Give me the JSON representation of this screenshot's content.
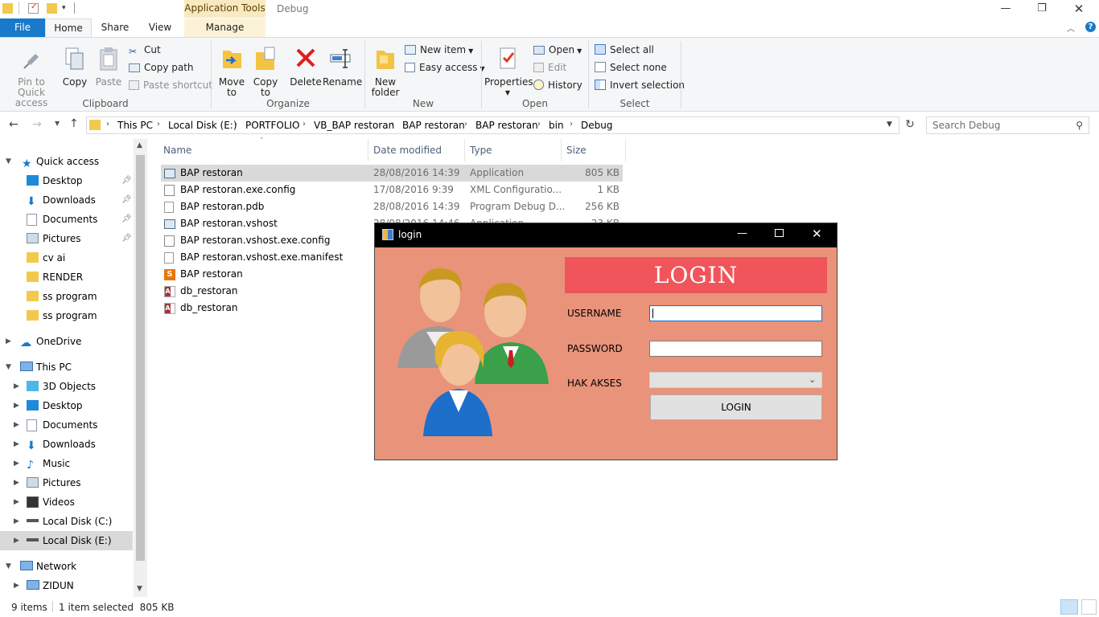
{
  "window": {
    "context_tab": "Application Tools",
    "title": "Debug",
    "controls": [
      "minimize",
      "restore",
      "close"
    ]
  },
  "tabs": {
    "file": "File",
    "home": "Home",
    "share": "Share",
    "view": "View",
    "manage": "Manage"
  },
  "ribbon": {
    "clipboard": {
      "label": "Clipboard",
      "pin": "Pin to Quick access",
      "copy": "Copy",
      "paste": "Paste",
      "cut": "Cut",
      "copy_path": "Copy path",
      "paste_shortcut": "Paste shortcut"
    },
    "organize": {
      "label": "Organize",
      "move_to": "Move to",
      "copy_to": "Copy to",
      "delete": "Delete",
      "rename": "Rename"
    },
    "new": {
      "label": "New",
      "new_folder": "New folder",
      "new_item": "New item",
      "easy_access": "Easy access"
    },
    "open": {
      "label": "Open",
      "properties": "Properties",
      "open": "Open",
      "edit": "Edit",
      "history": "History"
    },
    "select": {
      "label": "Select",
      "select_all": "Select all",
      "select_none": "Select none",
      "invert": "Invert selection"
    }
  },
  "address": {
    "crumbs": [
      "This PC",
      "Local Disk (E:)",
      "PORTFOLIO",
      "VB_BAP restoran",
      "BAP restoran",
      "BAP restoran",
      "bin",
      "Debug"
    ],
    "search_placeholder": "Search Debug"
  },
  "nav": {
    "quick_access": "Quick access",
    "quick_items": [
      "Desktop",
      "Downloads",
      "Documents",
      "Pictures",
      "cv ai",
      "RENDER",
      "ss program",
      "ss program"
    ],
    "onedrive": "OneDrive",
    "this_pc": "This PC",
    "pc_items": [
      "3D Objects",
      "Desktop",
      "Documents",
      "Downloads",
      "Music",
      "Pictures",
      "Videos",
      "Local Disk (C:)",
      "Local Disk (E:)"
    ],
    "network": "Network",
    "network_items": [
      "ZIDUN"
    ]
  },
  "columns": {
    "name": "Name",
    "date": "Date modified",
    "type": "Type",
    "size": "Size"
  },
  "files": [
    {
      "name": "BAP restoran",
      "date": "28/08/2016 14:39",
      "type": "Application",
      "size": "805 KB",
      "icon": "app-icon"
    },
    {
      "name": "BAP restoran.exe.config",
      "date": "17/08/2016 9:39",
      "type": "XML Configuratio...",
      "size": "1 KB",
      "icon": "config-icon"
    },
    {
      "name": "BAP restoran.pdb",
      "date": "28/08/2016 14:39",
      "type": "Program Debug D...",
      "size": "256 KB",
      "icon": "file-icon"
    },
    {
      "name": "BAP restoran.vshost",
      "date": "28/08/2016 14:46",
      "type": "Application",
      "size": "23 KB",
      "icon": "app-icon"
    },
    {
      "name": "BAP restoran.vshost.exe.config",
      "date": "",
      "type": "",
      "size": "",
      "icon": "config-icon"
    },
    {
      "name": "BAP restoran.vshost.exe.manifest",
      "date": "",
      "type": "",
      "size": "",
      "icon": "file-icon"
    },
    {
      "name": "BAP restoran",
      "date": "",
      "type": "",
      "size": "",
      "icon": "sublime-icon"
    },
    {
      "name": "db_restoran",
      "date": "",
      "type": "",
      "size": "",
      "icon": "access-icon"
    },
    {
      "name": "db_restoran",
      "date": "",
      "type": "",
      "size": "",
      "icon": "access-icon"
    }
  ],
  "status": {
    "count": "9 items",
    "selected": "1 item selected  805 KB"
  },
  "login": {
    "title": "login",
    "banner": "LOGIN",
    "username_label": "USERNAME",
    "password_label": "PASSWORD",
    "hak_akses_label": "HAK AKSES",
    "username_value": "",
    "password_value": "",
    "hak_akses_value": "",
    "button": "LOGIN"
  },
  "colors": {
    "file_tab": "#1979ca",
    "login_bg": "#e9937a",
    "login_banner": "#f0555b",
    "selected_row": "#d9d9d9"
  }
}
